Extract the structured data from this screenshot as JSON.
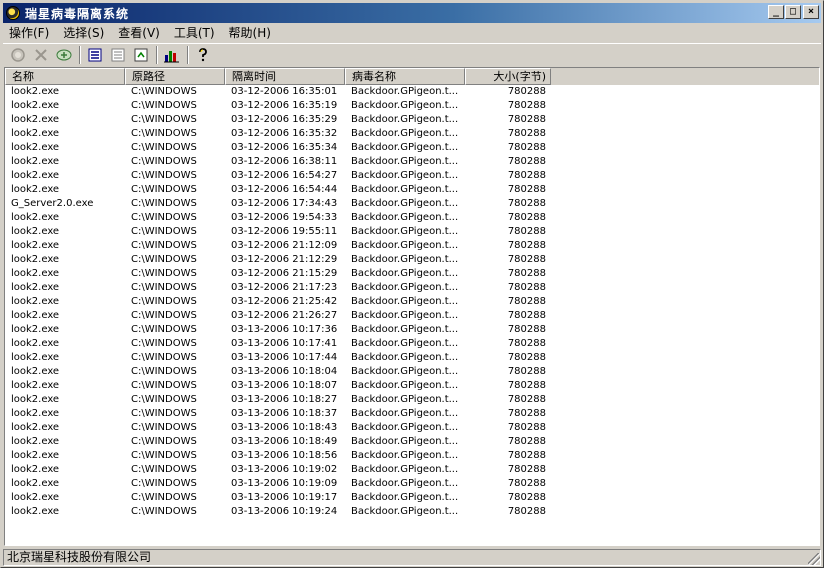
{
  "window": {
    "title": "瑞星病毒隔离系统"
  },
  "title_buttons": {
    "minimize": "_",
    "maximize": "□",
    "close": "×"
  },
  "menu": [
    {
      "label": "操作(F)"
    },
    {
      "label": "选择(S)"
    },
    {
      "label": "查看(V)"
    },
    {
      "label": "工具(T)"
    },
    {
      "label": "帮助(H)"
    }
  ],
  "toolbar": {
    "icons": [
      "recover-icon",
      "delete-icon",
      "add-icon",
      "large-icons-view-icon",
      "details-view-icon",
      "refresh-icon",
      "statistics-icon",
      "help-icon"
    ]
  },
  "columns": [
    "名称",
    "原路径",
    "隔离时间",
    "病毒名称",
    "大小(字节)"
  ],
  "rows": [
    [
      "look2.exe",
      "C:\\WINDOWS",
      "03-12-2006 16:35:01",
      "Backdoor.GPigeon.t...",
      "780288"
    ],
    [
      "look2.exe",
      "C:\\WINDOWS",
      "03-12-2006 16:35:19",
      "Backdoor.GPigeon.t...",
      "780288"
    ],
    [
      "look2.exe",
      "C:\\WINDOWS",
      "03-12-2006 16:35:29",
      "Backdoor.GPigeon.t...",
      "780288"
    ],
    [
      "look2.exe",
      "C:\\WINDOWS",
      "03-12-2006 16:35:32",
      "Backdoor.GPigeon.t...",
      "780288"
    ],
    [
      "look2.exe",
      "C:\\WINDOWS",
      "03-12-2006 16:35:34",
      "Backdoor.GPigeon.t...",
      "780288"
    ],
    [
      "look2.exe",
      "C:\\WINDOWS",
      "03-12-2006 16:38:11",
      "Backdoor.GPigeon.t...",
      "780288"
    ],
    [
      "look2.exe",
      "C:\\WINDOWS",
      "03-12-2006 16:54:27",
      "Backdoor.GPigeon.t...",
      "780288"
    ],
    [
      "look2.exe",
      "C:\\WINDOWS",
      "03-12-2006 16:54:44",
      "Backdoor.GPigeon.t...",
      "780288"
    ],
    [
      "G_Server2.0.exe",
      "C:\\WINDOWS",
      "03-12-2006 17:34:43",
      "Backdoor.GPigeon.t...",
      "780288"
    ],
    [
      "look2.exe",
      "C:\\WINDOWS",
      "03-12-2006 19:54:33",
      "Backdoor.GPigeon.t...",
      "780288"
    ],
    [
      "look2.exe",
      "C:\\WINDOWS",
      "03-12-2006 19:55:11",
      "Backdoor.GPigeon.t...",
      "780288"
    ],
    [
      "look2.exe",
      "C:\\WINDOWS",
      "03-12-2006 21:12:09",
      "Backdoor.GPigeon.t...",
      "780288"
    ],
    [
      "look2.exe",
      "C:\\WINDOWS",
      "03-12-2006 21:12:29",
      "Backdoor.GPigeon.t...",
      "780288"
    ],
    [
      "look2.exe",
      "C:\\WINDOWS",
      "03-12-2006 21:15:29",
      "Backdoor.GPigeon.t...",
      "780288"
    ],
    [
      "look2.exe",
      "C:\\WINDOWS",
      "03-12-2006 21:17:23",
      "Backdoor.GPigeon.t...",
      "780288"
    ],
    [
      "look2.exe",
      "C:\\WINDOWS",
      "03-12-2006 21:25:42",
      "Backdoor.GPigeon.t...",
      "780288"
    ],
    [
      "look2.exe",
      "C:\\WINDOWS",
      "03-12-2006 21:26:27",
      "Backdoor.GPigeon.t...",
      "780288"
    ],
    [
      "look2.exe",
      "C:\\WINDOWS",
      "03-13-2006 10:17:36",
      "Backdoor.GPigeon.t...",
      "780288"
    ],
    [
      "look2.exe",
      "C:\\WINDOWS",
      "03-13-2006 10:17:41",
      "Backdoor.GPigeon.t...",
      "780288"
    ],
    [
      "look2.exe",
      "C:\\WINDOWS",
      "03-13-2006 10:17:44",
      "Backdoor.GPigeon.t...",
      "780288"
    ],
    [
      "look2.exe",
      "C:\\WINDOWS",
      "03-13-2006 10:18:04",
      "Backdoor.GPigeon.t...",
      "780288"
    ],
    [
      "look2.exe",
      "C:\\WINDOWS",
      "03-13-2006 10:18:07",
      "Backdoor.GPigeon.t...",
      "780288"
    ],
    [
      "look2.exe",
      "C:\\WINDOWS",
      "03-13-2006 10:18:27",
      "Backdoor.GPigeon.t...",
      "780288"
    ],
    [
      "look2.exe",
      "C:\\WINDOWS",
      "03-13-2006 10:18:37",
      "Backdoor.GPigeon.t...",
      "780288"
    ],
    [
      "look2.exe",
      "C:\\WINDOWS",
      "03-13-2006 10:18:43",
      "Backdoor.GPigeon.t...",
      "780288"
    ],
    [
      "look2.exe",
      "C:\\WINDOWS",
      "03-13-2006 10:18:49",
      "Backdoor.GPigeon.t...",
      "780288"
    ],
    [
      "look2.exe",
      "C:\\WINDOWS",
      "03-13-2006 10:18:56",
      "Backdoor.GPigeon.t...",
      "780288"
    ],
    [
      "look2.exe",
      "C:\\WINDOWS",
      "03-13-2006 10:19:02",
      "Backdoor.GPigeon.t...",
      "780288"
    ],
    [
      "look2.exe",
      "C:\\WINDOWS",
      "03-13-2006 10:19:09",
      "Backdoor.GPigeon.t...",
      "780288"
    ],
    [
      "look2.exe",
      "C:\\WINDOWS",
      "03-13-2006 10:19:17",
      "Backdoor.GPigeon.t...",
      "780288"
    ],
    [
      "look2.exe",
      "C:\\WINDOWS",
      "03-13-2006 10:19:24",
      "Backdoor.GPigeon.t...",
      "780288"
    ]
  ],
  "status": {
    "text": "北京瑞星科技股份有限公司"
  },
  "colors": {
    "title_start": "#0a246a",
    "title_end": "#a6caf0",
    "chrome": "#d4d0c8"
  }
}
